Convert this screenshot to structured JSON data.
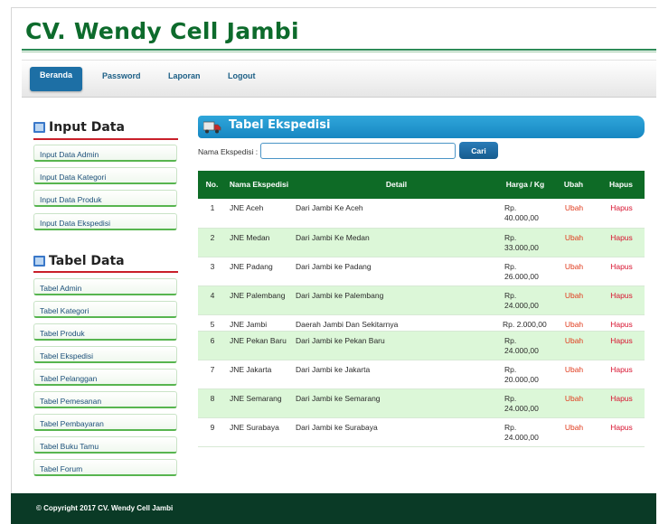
{
  "site": {
    "title": "CV. Wendy Cell Jambi"
  },
  "nav": [
    {
      "label": "Beranda"
    },
    {
      "label": "Password"
    },
    {
      "label": "Laporan"
    },
    {
      "label": "Logout"
    }
  ],
  "sidebar": {
    "input_heading": "Input Data",
    "input_items": [
      {
        "label": "Input Data Admin"
      },
      {
        "label": "Input Data Kategori"
      },
      {
        "label": "Input Data Produk"
      },
      {
        "label": "Input Data Ekspedisi"
      }
    ],
    "table_heading": "Tabel Data",
    "table_items": [
      {
        "label": "Tabel Admin"
      },
      {
        "label": "Tabel Kategori"
      },
      {
        "label": "Tabel Produk"
      },
      {
        "label": "Tabel Ekspedisi"
      },
      {
        "label": "Tabel Pelanggan"
      },
      {
        "label": "Tabel Pemesanan"
      },
      {
        "label": "Tabel Pembayaran"
      },
      {
        "label": "Tabel Buku Tamu"
      },
      {
        "label": "Tabel Forum"
      }
    ]
  },
  "main": {
    "title": "Tabel Ekspedisi",
    "search": {
      "label": "Nama Ekspedisi :",
      "value": "",
      "placeholder": "",
      "button": "Cari"
    },
    "table": {
      "headers": [
        "No.",
        "Nama Ekspedisi",
        "Detail",
        "Harga / Kg",
        "Ubah",
        "Hapus"
      ],
      "rows": [
        {
          "no": "1",
          "nama": "JNE Aceh",
          "detail": "Dari Jambi Ke Aceh",
          "harga": "Rp. 40.000,00",
          "ubah": "Ubah",
          "hapus": "Hapus"
        },
        {
          "no": "2",
          "nama": "JNE Medan",
          "detail": "Dari Jambi Ke Medan",
          "harga": "Rp. 33.000,00",
          "ubah": "Ubah",
          "hapus": "Hapus"
        },
        {
          "no": "3",
          "nama": "JNE Padang",
          "detail": "Dari Jambi ke Padang",
          "harga": "Rp. 26.000,00",
          "ubah": "Ubah",
          "hapus": "Hapus"
        },
        {
          "no": "4",
          "nama": "JNE Palembang",
          "detail": "Dari Jambi ke Palembang",
          "harga": "Rp. 24.000,00",
          "ubah": "Ubah",
          "hapus": "Hapus"
        },
        {
          "no": "5",
          "nama": "JNE Jambi",
          "detail": "Daerah Jambi Dan Sekitarnya",
          "harga": "Rp. 2.000,00",
          "ubah": "Ubah",
          "hapus": "Hapus"
        },
        {
          "no": "6",
          "nama": "JNE Pekan Baru",
          "detail": "Dari Jambi ke Pekan Baru",
          "harga": "Rp. 24.000,00",
          "ubah": "Ubah",
          "hapus": "Hapus"
        },
        {
          "no": "7",
          "nama": "JNE Jakarta",
          "detail": "Dari Jambi ke Jakarta",
          "harga": "Rp. 20.000,00",
          "ubah": "Ubah",
          "hapus": "Hapus"
        },
        {
          "no": "8",
          "nama": "JNE Semarang",
          "detail": "Dari Jambi ke Semarang",
          "harga": "Rp. 24.000,00",
          "ubah": "Ubah",
          "hapus": "Hapus"
        },
        {
          "no": "9",
          "nama": "JNE Surabaya",
          "detail": "Dari Jambi ke Surabaya",
          "harga": "Rp. 24.000,00",
          "ubah": "Ubah",
          "hapus": "Hapus"
        }
      ]
    }
  },
  "footer": {
    "text": "© Copyright 2017 CV. Wendy Cell Jambi"
  },
  "colors": {
    "brand_green": "#0d6b2c",
    "nav_blue": "#1d6fa5",
    "panel_blue": "#1f95cf",
    "table_header": "#0e6b26",
    "row_alt": "#dcf7d8",
    "link_red": "#d8132f",
    "footer": "#0a3a26"
  }
}
